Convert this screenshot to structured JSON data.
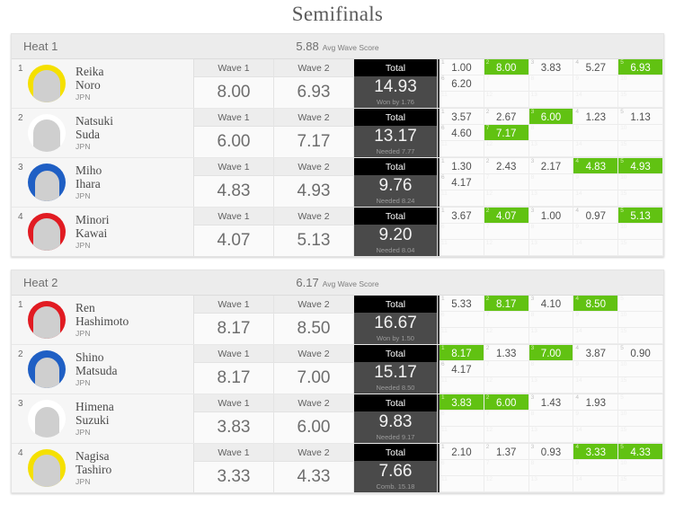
{
  "page": {
    "title": "Semifinals",
    "avg_label": "Avg Wave Score",
    "wave1_label": "Wave 1",
    "wave2_label": "Wave 2",
    "total_label": "Total",
    "accent_green": "#61c212",
    "total_header_bg": "#000000",
    "total_body_bg": "#4a4a4a"
  },
  "heats": [
    {
      "name": "Heat 1",
      "avg_wave_score": "5.88",
      "athletes": [
        {
          "seed": "1",
          "first_name": "Reika",
          "last_name": "Noro",
          "country": "JPN",
          "jersey_color": "#f5e000",
          "has_photo": true,
          "wave1": "8.00",
          "wave2": "6.93",
          "total": "14.93",
          "total_note": "Won by 1.76",
          "waves": [
            {
              "n": "1",
              "v": "1.00",
              "counted": false
            },
            {
              "n": "2",
              "v": "8.00",
              "counted": true
            },
            {
              "n": "3",
              "v": "3.83",
              "counted": false
            },
            {
              "n": "4",
              "v": "5.27",
              "counted": false
            },
            {
              "n": "5",
              "v": "6.93",
              "counted": true
            },
            {
              "n": "6",
              "v": "6.20",
              "counted": false
            },
            {
              "n": "7",
              "v": "",
              "counted": false
            },
            {
              "n": "8",
              "v": "",
              "counted": false
            },
            {
              "n": "9",
              "v": "",
              "counted": false
            },
            {
              "n": "10",
              "v": "",
              "counted": false
            },
            {
              "n": "11",
              "v": "",
              "counted": false
            },
            {
              "n": "12",
              "v": "",
              "counted": false
            },
            {
              "n": "13",
              "v": "",
              "counted": false
            },
            {
              "n": "14",
              "v": "",
              "counted": false
            },
            {
              "n": "15",
              "v": "",
              "counted": false
            }
          ]
        },
        {
          "seed": "2",
          "first_name": "Natsuki",
          "last_name": "Suda",
          "country": "JPN",
          "jersey_color": "#ffffff",
          "has_photo": true,
          "wave1": "6.00",
          "wave2": "7.17",
          "total": "13.17",
          "total_note": "Needed 7.77",
          "waves": [
            {
              "n": "1",
              "v": "3.57",
              "counted": false
            },
            {
              "n": "2",
              "v": "2.67",
              "counted": false
            },
            {
              "n": "3",
              "v": "6.00",
              "counted": true
            },
            {
              "n": "4",
              "v": "1.23",
              "counted": false
            },
            {
              "n": "5",
              "v": "1.13",
              "counted": false
            },
            {
              "n": "6",
              "v": "4.60",
              "counted": false
            },
            {
              "n": "7",
              "v": "7.17",
              "counted": true
            },
            {
              "n": "8",
              "v": "",
              "counted": false
            },
            {
              "n": "9",
              "v": "",
              "counted": false
            },
            {
              "n": "10",
              "v": "",
              "counted": false
            },
            {
              "n": "11",
              "v": "",
              "counted": false
            },
            {
              "n": "12",
              "v": "",
              "counted": false
            },
            {
              "n": "13",
              "v": "",
              "counted": false
            },
            {
              "n": "14",
              "v": "",
              "counted": false
            },
            {
              "n": "15",
              "v": "",
              "counted": false
            }
          ]
        },
        {
          "seed": "3",
          "first_name": "Miho",
          "last_name": "Ihara",
          "country": "JPN",
          "jersey_color": "#1f5fc4",
          "has_photo": false,
          "wave1": "4.83",
          "wave2": "4.93",
          "total": "9.76",
          "total_note": "Needed 8.24",
          "waves": [
            {
              "n": "1",
              "v": "1.30",
              "counted": false
            },
            {
              "n": "2",
              "v": "2.43",
              "counted": false
            },
            {
              "n": "3",
              "v": "2.17",
              "counted": false
            },
            {
              "n": "4",
              "v": "4.83",
              "counted": true
            },
            {
              "n": "5",
              "v": "4.93",
              "counted": true
            },
            {
              "n": "6",
              "v": "4.17",
              "counted": false
            },
            {
              "n": "7",
              "v": "",
              "counted": false
            },
            {
              "n": "8",
              "v": "",
              "counted": false
            },
            {
              "n": "9",
              "v": "",
              "counted": false
            },
            {
              "n": "10",
              "v": "",
              "counted": false
            },
            {
              "n": "11",
              "v": "",
              "counted": false
            },
            {
              "n": "12",
              "v": "",
              "counted": false
            },
            {
              "n": "13",
              "v": "",
              "counted": false
            },
            {
              "n": "14",
              "v": "",
              "counted": false
            },
            {
              "n": "15",
              "v": "",
              "counted": false
            }
          ]
        },
        {
          "seed": "4",
          "first_name": "Minori",
          "last_name": "Kawai",
          "country": "JPN",
          "jersey_color": "#e11b22",
          "has_photo": true,
          "wave1": "4.07",
          "wave2": "5.13",
          "total": "9.20",
          "total_note": "Needed 8.04",
          "waves": [
            {
              "n": "1",
              "v": "3.67",
              "counted": false
            },
            {
              "n": "2",
              "v": "4.07",
              "counted": true
            },
            {
              "n": "3",
              "v": "1.00",
              "counted": false
            },
            {
              "n": "4",
              "v": "0.97",
              "counted": false
            },
            {
              "n": "5",
              "v": "5.13",
              "counted": true
            },
            {
              "n": "6",
              "v": "",
              "counted": false
            },
            {
              "n": "7",
              "v": "",
              "counted": false
            },
            {
              "n": "8",
              "v": "",
              "counted": false
            },
            {
              "n": "9",
              "v": "",
              "counted": false
            },
            {
              "n": "10",
              "v": "",
              "counted": false
            },
            {
              "n": "11",
              "v": "",
              "counted": false
            },
            {
              "n": "12",
              "v": "",
              "counted": false
            },
            {
              "n": "13",
              "v": "",
              "counted": false
            },
            {
              "n": "14",
              "v": "",
              "counted": false
            },
            {
              "n": "15",
              "v": "",
              "counted": false
            }
          ]
        }
      ]
    },
    {
      "name": "Heat 2",
      "avg_wave_score": "6.17",
      "athletes": [
        {
          "seed": "1",
          "first_name": "Ren",
          "last_name": "Hashimoto",
          "country": "JPN",
          "jersey_color": "#e11b22",
          "has_photo": true,
          "wave1": "8.17",
          "wave2": "8.50",
          "total": "16.67",
          "total_note": "Won by 1.50",
          "waves": [
            {
              "n": "1",
              "v": "5.33",
              "counted": false
            },
            {
              "n": "2",
              "v": "8.17",
              "counted": true
            },
            {
              "n": "3",
              "v": "4.10",
              "counted": false
            },
            {
              "n": "4",
              "v": "8.50",
              "counted": true
            },
            {
              "n": "5",
              "v": "",
              "counted": false
            },
            {
              "n": "6",
              "v": "",
              "counted": false
            },
            {
              "n": "7",
              "v": "",
              "counted": false
            },
            {
              "n": "8",
              "v": "",
              "counted": false
            },
            {
              "n": "9",
              "v": "",
              "counted": false
            },
            {
              "n": "10",
              "v": "",
              "counted": false
            },
            {
              "n": "11",
              "v": "",
              "counted": false
            },
            {
              "n": "12",
              "v": "",
              "counted": false
            },
            {
              "n": "13",
              "v": "",
              "counted": false
            },
            {
              "n": "14",
              "v": "",
              "counted": false
            },
            {
              "n": "15",
              "v": "",
              "counted": false
            }
          ]
        },
        {
          "seed": "2",
          "first_name": "Shino",
          "last_name": "Matsuda",
          "country": "JPN",
          "jersey_color": "#1f5fc4",
          "has_photo": false,
          "wave1": "8.17",
          "wave2": "7.00",
          "total": "15.17",
          "total_note": "Needed 8.50",
          "waves": [
            {
              "n": "1",
              "v": "8.17",
              "counted": true
            },
            {
              "n": "2",
              "v": "1.33",
              "counted": false
            },
            {
              "n": "3",
              "v": "7.00",
              "counted": true
            },
            {
              "n": "4",
              "v": "3.87",
              "counted": false
            },
            {
              "n": "5",
              "v": "0.90",
              "counted": false
            },
            {
              "n": "6",
              "v": "4.17",
              "counted": false
            },
            {
              "n": "7",
              "v": "",
              "counted": false
            },
            {
              "n": "8",
              "v": "",
              "counted": false
            },
            {
              "n": "9",
              "v": "",
              "counted": false
            },
            {
              "n": "10",
              "v": "",
              "counted": false
            },
            {
              "n": "11",
              "v": "",
              "counted": false
            },
            {
              "n": "12",
              "v": "",
              "counted": false
            },
            {
              "n": "13",
              "v": "",
              "counted": false
            },
            {
              "n": "14",
              "v": "",
              "counted": false
            },
            {
              "n": "15",
              "v": "",
              "counted": false
            }
          ]
        },
        {
          "seed": "3",
          "first_name": "Himena",
          "last_name": "Suzuki",
          "country": "JPN",
          "jersey_color": "#ffffff",
          "has_photo": false,
          "wave1": "3.83",
          "wave2": "6.00",
          "total": "9.83",
          "total_note": "Needed 9.17",
          "waves": [
            {
              "n": "1",
              "v": "3.83",
              "counted": true
            },
            {
              "n": "2",
              "v": "6.00",
              "counted": true
            },
            {
              "n": "3",
              "v": "1.43",
              "counted": false
            },
            {
              "n": "4",
              "v": "1.93",
              "counted": false
            },
            {
              "n": "5",
              "v": "",
              "counted": false
            },
            {
              "n": "6",
              "v": "",
              "counted": false
            },
            {
              "n": "7",
              "v": "",
              "counted": false
            },
            {
              "n": "8",
              "v": "",
              "counted": false
            },
            {
              "n": "9",
              "v": "",
              "counted": false
            },
            {
              "n": "10",
              "v": "",
              "counted": false
            },
            {
              "n": "11",
              "v": "",
              "counted": false
            },
            {
              "n": "12",
              "v": "",
              "counted": false
            },
            {
              "n": "13",
              "v": "",
              "counted": false
            },
            {
              "n": "14",
              "v": "",
              "counted": false
            },
            {
              "n": "15",
              "v": "",
              "counted": false
            }
          ]
        },
        {
          "seed": "4",
          "first_name": "Nagisa",
          "last_name": "Tashiro",
          "country": "JPN",
          "jersey_color": "#f5e000",
          "has_photo": true,
          "wave1": "3.33",
          "wave2": "4.33",
          "total": "7.66",
          "total_note": "Comb. 15.18",
          "waves": [
            {
              "n": "1",
              "v": "2.10",
              "counted": false
            },
            {
              "n": "2",
              "v": "1.37",
              "counted": false
            },
            {
              "n": "3",
              "v": "0.93",
              "counted": false
            },
            {
              "n": "4",
              "v": "3.33",
              "counted": true
            },
            {
              "n": "5",
              "v": "4.33",
              "counted": true
            },
            {
              "n": "6",
              "v": "",
              "counted": false
            },
            {
              "n": "7",
              "v": "",
              "counted": false
            },
            {
              "n": "8",
              "v": "",
              "counted": false
            },
            {
              "n": "9",
              "v": "",
              "counted": false
            },
            {
              "n": "10",
              "v": "",
              "counted": false
            },
            {
              "n": "11",
              "v": "",
              "counted": false
            },
            {
              "n": "12",
              "v": "",
              "counted": false
            },
            {
              "n": "13",
              "v": "",
              "counted": false
            },
            {
              "n": "14",
              "v": "",
              "counted": false
            },
            {
              "n": "15",
              "v": "",
              "counted": false
            }
          ]
        }
      ]
    }
  ]
}
